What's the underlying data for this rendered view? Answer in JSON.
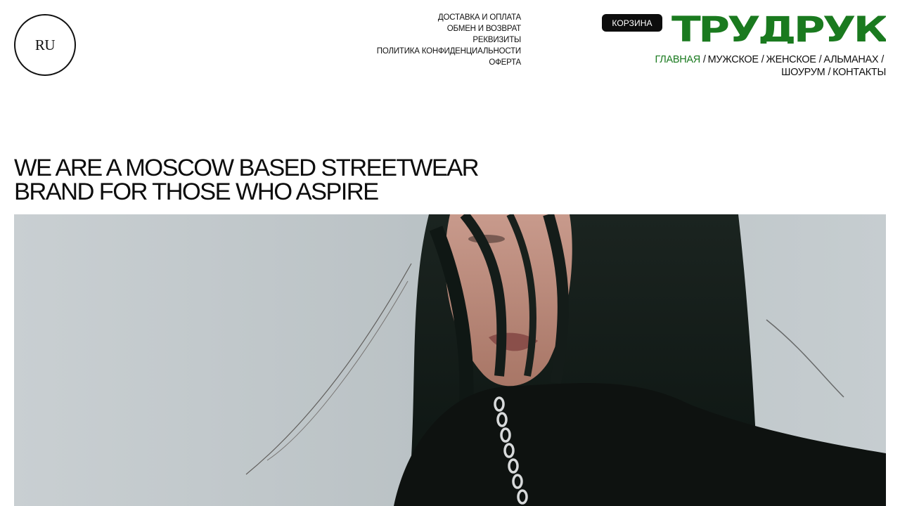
{
  "lang": {
    "label": "RU"
  },
  "info_links": [
    "ДОСТАВКА И ОПЛАТА",
    "ОБМЕН И ВОЗВРАТ",
    "РЕКВИЗИТЫ",
    "ПОЛИТИКА КОНФИДЕНЦИАЛЬНОСТИ",
    "ОФЕРТА"
  ],
  "cart": {
    "label": "КОРЗИНА"
  },
  "logo": {
    "text": "ТРУДРУК",
    "color": "#1a7a1f"
  },
  "nav": {
    "items": [
      "ГЛАВНАЯ",
      "МУЖСКОЕ",
      "ЖЕНСКОЕ",
      "АЛЬМАНАХ",
      "ШОУРУМ",
      "КОНТАКТЫ"
    ],
    "separator": "/",
    "active_color": "#1a7a1f"
  },
  "hero": {
    "tagline_line1": "WE ARE A MOSCOW BASED STREETWEAR",
    "tagline_line2": "BRAND FOR THOSE WHO ASPIRE"
  }
}
